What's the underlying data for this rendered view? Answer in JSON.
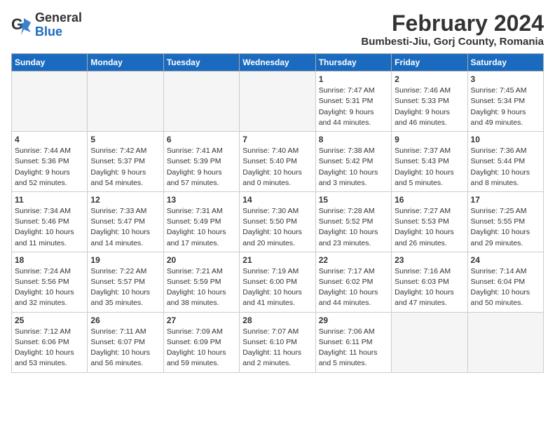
{
  "header": {
    "logo_general": "General",
    "logo_blue": "Blue",
    "month_title": "February 2024",
    "location": "Bumbesti-Jiu, Gorj County, Romania"
  },
  "weekdays": [
    "Sunday",
    "Monday",
    "Tuesday",
    "Wednesday",
    "Thursday",
    "Friday",
    "Saturday"
  ],
  "weeks": [
    [
      {
        "day": "",
        "info": ""
      },
      {
        "day": "",
        "info": ""
      },
      {
        "day": "",
        "info": ""
      },
      {
        "day": "",
        "info": ""
      },
      {
        "day": "1",
        "info": "Sunrise: 7:47 AM\nSunset: 5:31 PM\nDaylight: 9 hours\nand 44 minutes."
      },
      {
        "day": "2",
        "info": "Sunrise: 7:46 AM\nSunset: 5:33 PM\nDaylight: 9 hours\nand 46 minutes."
      },
      {
        "day": "3",
        "info": "Sunrise: 7:45 AM\nSunset: 5:34 PM\nDaylight: 9 hours\nand 49 minutes."
      }
    ],
    [
      {
        "day": "4",
        "info": "Sunrise: 7:44 AM\nSunset: 5:36 PM\nDaylight: 9 hours\nand 52 minutes."
      },
      {
        "day": "5",
        "info": "Sunrise: 7:42 AM\nSunset: 5:37 PM\nDaylight: 9 hours\nand 54 minutes."
      },
      {
        "day": "6",
        "info": "Sunrise: 7:41 AM\nSunset: 5:39 PM\nDaylight: 9 hours\nand 57 minutes."
      },
      {
        "day": "7",
        "info": "Sunrise: 7:40 AM\nSunset: 5:40 PM\nDaylight: 10 hours\nand 0 minutes."
      },
      {
        "day": "8",
        "info": "Sunrise: 7:38 AM\nSunset: 5:42 PM\nDaylight: 10 hours\nand 3 minutes."
      },
      {
        "day": "9",
        "info": "Sunrise: 7:37 AM\nSunset: 5:43 PM\nDaylight: 10 hours\nand 5 minutes."
      },
      {
        "day": "10",
        "info": "Sunrise: 7:36 AM\nSunset: 5:44 PM\nDaylight: 10 hours\nand 8 minutes."
      }
    ],
    [
      {
        "day": "11",
        "info": "Sunrise: 7:34 AM\nSunset: 5:46 PM\nDaylight: 10 hours\nand 11 minutes."
      },
      {
        "day": "12",
        "info": "Sunrise: 7:33 AM\nSunset: 5:47 PM\nDaylight: 10 hours\nand 14 minutes."
      },
      {
        "day": "13",
        "info": "Sunrise: 7:31 AM\nSunset: 5:49 PM\nDaylight: 10 hours\nand 17 minutes."
      },
      {
        "day": "14",
        "info": "Sunrise: 7:30 AM\nSunset: 5:50 PM\nDaylight: 10 hours\nand 20 minutes."
      },
      {
        "day": "15",
        "info": "Sunrise: 7:28 AM\nSunset: 5:52 PM\nDaylight: 10 hours\nand 23 minutes."
      },
      {
        "day": "16",
        "info": "Sunrise: 7:27 AM\nSunset: 5:53 PM\nDaylight: 10 hours\nand 26 minutes."
      },
      {
        "day": "17",
        "info": "Sunrise: 7:25 AM\nSunset: 5:55 PM\nDaylight: 10 hours\nand 29 minutes."
      }
    ],
    [
      {
        "day": "18",
        "info": "Sunrise: 7:24 AM\nSunset: 5:56 PM\nDaylight: 10 hours\nand 32 minutes."
      },
      {
        "day": "19",
        "info": "Sunrise: 7:22 AM\nSunset: 5:57 PM\nDaylight: 10 hours\nand 35 minutes."
      },
      {
        "day": "20",
        "info": "Sunrise: 7:21 AM\nSunset: 5:59 PM\nDaylight: 10 hours\nand 38 minutes."
      },
      {
        "day": "21",
        "info": "Sunrise: 7:19 AM\nSunset: 6:00 PM\nDaylight: 10 hours\nand 41 minutes."
      },
      {
        "day": "22",
        "info": "Sunrise: 7:17 AM\nSunset: 6:02 PM\nDaylight: 10 hours\nand 44 minutes."
      },
      {
        "day": "23",
        "info": "Sunrise: 7:16 AM\nSunset: 6:03 PM\nDaylight: 10 hours\nand 47 minutes."
      },
      {
        "day": "24",
        "info": "Sunrise: 7:14 AM\nSunset: 6:04 PM\nDaylight: 10 hours\nand 50 minutes."
      }
    ],
    [
      {
        "day": "25",
        "info": "Sunrise: 7:12 AM\nSunset: 6:06 PM\nDaylight: 10 hours\nand 53 minutes."
      },
      {
        "day": "26",
        "info": "Sunrise: 7:11 AM\nSunset: 6:07 PM\nDaylight: 10 hours\nand 56 minutes."
      },
      {
        "day": "27",
        "info": "Sunrise: 7:09 AM\nSunset: 6:09 PM\nDaylight: 10 hours\nand 59 minutes."
      },
      {
        "day": "28",
        "info": "Sunrise: 7:07 AM\nSunset: 6:10 PM\nDaylight: 11 hours\nand 2 minutes."
      },
      {
        "day": "29",
        "info": "Sunrise: 7:06 AM\nSunset: 6:11 PM\nDaylight: 11 hours\nand 5 minutes."
      },
      {
        "day": "",
        "info": ""
      },
      {
        "day": "",
        "info": ""
      }
    ]
  ]
}
